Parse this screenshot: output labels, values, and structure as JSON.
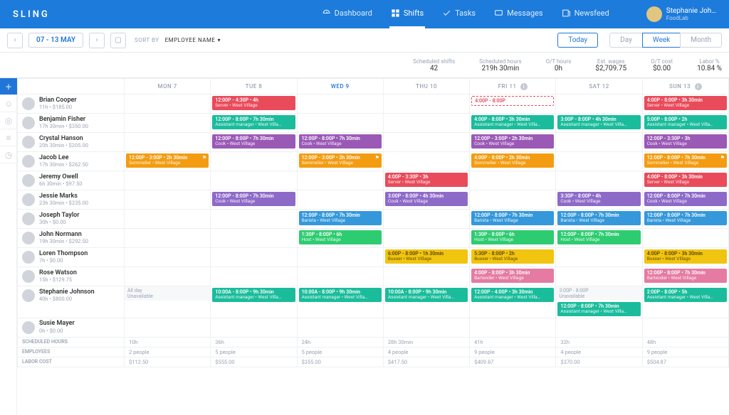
{
  "brand": "SLING",
  "nav": {
    "dashboard": "Dashboard",
    "shifts": "Shifts",
    "tasks": "Tasks",
    "messages": "Messages",
    "newsfeed": "Newsfeed"
  },
  "profile": {
    "name": "Stephanie Joh…",
    "company": "FoodLab"
  },
  "dateRange": "07 - 13 MAY",
  "sort": {
    "label": "SORT BY",
    "value": "EMPLOYEE NAME"
  },
  "today": "Today",
  "views": {
    "day": "Day",
    "week": "Week",
    "month": "Month"
  },
  "stats": {
    "schedShifts": {
      "label": "Scheduled shifts",
      "value": "42"
    },
    "schedHours": {
      "label": "Scheduled hours",
      "value": "219h 30min"
    },
    "otHours": {
      "label": "O/T hours",
      "value": "0h"
    },
    "estWages": {
      "label": "Est. wages",
      "value": "$2,709.75"
    },
    "otCost": {
      "label": "O/T cost",
      "value": "$0.00"
    },
    "laborPct": {
      "label": "Labor %",
      "value": "10.84 %"
    }
  },
  "days": [
    "MON 7",
    "TUE 8",
    "WED 9",
    "THU 10",
    "FRI 11",
    "SAT 12",
    "SUN 13"
  ],
  "employees": [
    {
      "name": "Brian Cooper",
      "sub": "11h • $185.00",
      "shifts": [
        null,
        {
          "c": "red",
          "t": "12:00P - 4:30P • 4h",
          "r": "Server • West Village"
        },
        null,
        null,
        {
          "c": "outline",
          "t": "4:00P - 8:00P",
          "r": ""
        },
        null,
        {
          "c": "red",
          "t": "4:00P - 8:00P • 3h 30min",
          "r": "Server • West Village"
        }
      ]
    },
    {
      "name": "Benjamin Fisher",
      "sub": "17h 30min • $350.00",
      "shifts": [
        null,
        {
          "c": "teal",
          "t": "12:00P - 8:00P • 7h 30min",
          "r": "Assistant manager • West Villa…"
        },
        null,
        null,
        {
          "c": "teal",
          "t": "4:00P - 8:00P • 3h 30min",
          "r": "Assistant manager • West Villa…"
        },
        {
          "c": "teal",
          "t": "3:00P - 8:00P • 4h 30min",
          "r": "Assistant manager • West Villa…"
        },
        {
          "c": "teal",
          "t": "5:00P - 8:00P • 2h",
          "r": "Assistant manager • West Villa…"
        }
      ]
    },
    {
      "name": "Crystal Hanson",
      "sub": "20h 30min • $205.00",
      "shifts": [
        null,
        {
          "c": "purple",
          "t": "12:00P - 8:00P • 7h 30min",
          "r": "Cook • West Village"
        },
        {
          "c": "purple",
          "t": "12:00P - 8:00P • 7h 30min",
          "r": "Cook • West Village"
        },
        null,
        {
          "c": "purple",
          "t": "12:00P - 3:00P • 2h 30min",
          "r": "Cook • West Village"
        },
        null,
        {
          "c": "purple",
          "t": "12:00P - 3:30P • 3h",
          "r": "Cook • West Village"
        }
      ]
    },
    {
      "name": "Jacob Lee",
      "sub": "17h 30min • $262.50",
      "shifts": [
        {
          "c": "orange",
          "t": "12:00P - 3:00P • 2h 30min",
          "r": "Sommelier • West Village",
          "flag": "⚑"
        },
        null,
        {
          "c": "orange",
          "t": "12:00P - 3:00P • 2h 30min",
          "r": "Sommelier • West Village",
          "flag": "⚑"
        },
        null,
        {
          "c": "orange",
          "t": "4:00P - 8:00P • 2h 30min",
          "r": "Sommelier • West Village"
        },
        null,
        {
          "c": "orange",
          "t": "12:00P - 8:00P • 7h 30min",
          "r": "Sommelier • West Village",
          "flag": "⚑"
        }
      ]
    },
    {
      "name": "Jeremy Owell",
      "sub": "6h 30min • $97.50",
      "shifts": [
        null,
        null,
        null,
        {
          "c": "red",
          "t": "4:00P - 3:30P • 3h",
          "r": "Server • West Village"
        },
        null,
        null,
        {
          "c": "red",
          "t": "4:00P - 8:00P • 3h 30min",
          "r": "Server • West Village"
        }
      ]
    },
    {
      "name": "Jessie Marks",
      "sub": "23h 30min • $235.00",
      "shifts": [
        null,
        {
          "c": "violet",
          "t": "12:00P - 8:00P • 7h 30min",
          "r": "Cook • West Village"
        },
        null,
        {
          "c": "violet",
          "t": "3:00P - 8:00P • 4h 30min",
          "r": "Cook • West Village"
        },
        null,
        {
          "c": "violet",
          "t": "3:30P - 8:00P • 4h",
          "r": "Cook • West Village"
        },
        {
          "c": "violet",
          "t": "12:00P - 8:00P • 7h 30min",
          "r": "Cook • West Village"
        }
      ]
    },
    {
      "name": "Joseph Taylor",
      "sub": "30h • $0.00",
      "shifts": [
        null,
        null,
        {
          "c": "blue",
          "t": "12:00P - 8:00P • 7h 30min",
          "r": "Barista • West Village"
        },
        null,
        {
          "c": "blue",
          "t": "12:00P - 8:00P • 7h 30min",
          "r": "Barista • West Village"
        },
        {
          "c": "blue",
          "t": "12:00P - 8:00P • 7h 30min",
          "r": "Barista • West Village"
        },
        {
          "c": "blue",
          "t": "12:00P - 8:00P • 7h 30min",
          "r": "Barista • West Village"
        }
      ]
    },
    {
      "name": "John Normann",
      "sub": "19h 30min • $292.50",
      "shifts": [
        null,
        null,
        {
          "c": "green",
          "t": "1:30P - 8:00P • 6h",
          "r": "Host • West Village"
        },
        null,
        {
          "c": "green",
          "t": "1:30P - 8:00P • 6h",
          "r": "Host • West Village"
        },
        {
          "c": "green",
          "t": "12:00P - 8:00P • 7h 30min",
          "r": "Host • West Village"
        },
        null
      ]
    },
    {
      "name": "Loren Thompson",
      "sub": "7h • $0.00",
      "shifts": [
        null,
        null,
        null,
        {
          "c": "yellow",
          "t": "6:00P - 8:00P • 1h 30min",
          "r": "Busser • West Village"
        },
        {
          "c": "yellow",
          "t": "5:30P - 8:00P • 2h",
          "r": "Busser • West Village"
        },
        null,
        {
          "c": "yellow",
          "t": "4:00P - 8:00P • 3h 30min",
          "r": "Busser • West Village"
        }
      ]
    },
    {
      "name": "Rose Watson",
      "sub": "15h • $129.75",
      "shifts": [
        null,
        null,
        null,
        null,
        {
          "c": "pink",
          "t": "4:00P - 8:00P • 3h 30min",
          "r": "Bartender • West Village"
        },
        null,
        {
          "c": "pink",
          "t": "12:00P - 8:00P • 7h 30min",
          "r": "Bartender • West Village"
        }
      ]
    },
    {
      "name": "Stephanie Johnson",
      "sub": "40h • $800.00",
      "shifts": [
        {
          "c": "unavail",
          "t": "All day",
          "r": "Unavailable"
        },
        {
          "c": "teal",
          "t": "10:00A - 8:00P • 9h 30min",
          "r": "Assistant manager • West Villa…"
        },
        {
          "c": "teal",
          "t": "10:00A - 8:00P • 9h 30min",
          "r": "Assistant manager • West Villa…"
        },
        {
          "c": "teal",
          "t": "10:00A - 8:00P • 9h 30min",
          "r": "Assistant manager • West Villa…"
        },
        {
          "c": "teal",
          "t": "12:00P - 4:00P • 3h 30min",
          "r": "Assistant manager • West Villa…"
        },
        [
          {
            "c": "unavail",
            "t": "3:00P - 8:00P",
            "r": "Unavailable"
          },
          {
            "c": "teal",
            "t": "12:00P - 8:00P • 7h 30min",
            "r": "Assistant manager • West Villa…"
          }
        ],
        {
          "c": "teal",
          "t": "2:00P - 8:00P • 5h",
          "r": "Assistant manager • West Villa…"
        }
      ]
    },
    {
      "name": "Susie Mayer",
      "sub": "0h • $0.00",
      "shifts": [
        null,
        null,
        null,
        null,
        null,
        null,
        null
      ]
    }
  ],
  "footer": {
    "rows": [
      {
        "label": "SCHEDULED HOURS",
        "vals": [
          "10h",
          "36h",
          "24h",
          "28h 30min",
          "41h",
          "32h",
          "48h"
        ]
      },
      {
        "label": "EMPLOYEES",
        "vals": [
          "2 people",
          "5 people",
          "5 people",
          "4 people",
          "9 people",
          "4 people",
          "9 people"
        ]
      },
      {
        "label": "LABOR COST",
        "vals": [
          "$112.50",
          "$555.00",
          "$355.00",
          "$417.50",
          "$409.87",
          "$370.00",
          "$504.87"
        ]
      }
    ]
  }
}
